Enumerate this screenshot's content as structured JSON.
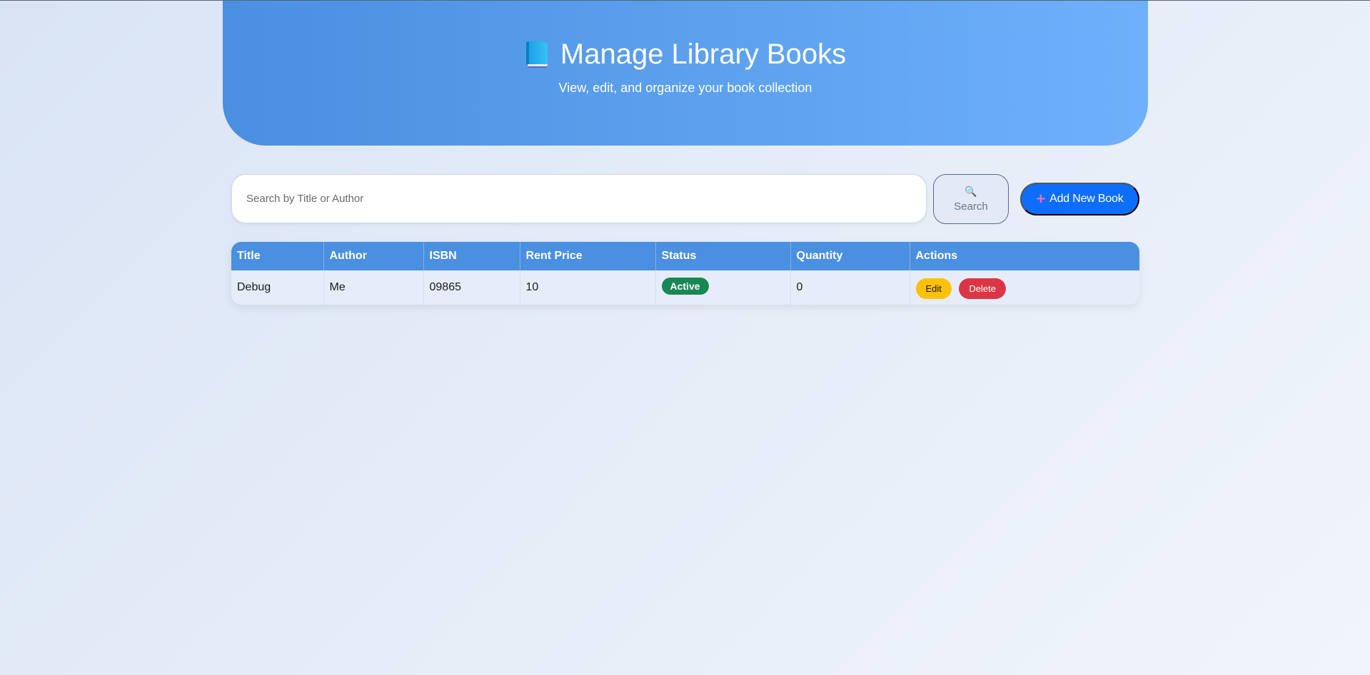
{
  "header": {
    "title": "Manage Library Books",
    "subtitle": "View, edit, and organize your book collection",
    "icon": "blue-book-icon"
  },
  "search": {
    "placeholder": "Search by Title or Author",
    "value": "",
    "button_label": "Search",
    "button_icon": "magnifier-icon"
  },
  "add_button": {
    "label": "Add New Book",
    "icon": "plus-icon"
  },
  "table": {
    "columns": [
      "Title",
      "Author",
      "ISBN",
      "Rent Price",
      "Status",
      "Quantity",
      "Actions"
    ],
    "rows": [
      {
        "title": "Debug",
        "author": "Me",
        "isbn": "09865",
        "rent_price": "10",
        "status": "Active",
        "quantity": "0",
        "edit_label": "Edit",
        "delete_label": "Delete"
      }
    ]
  },
  "colors": {
    "header_gradient_start": "#4a8fe0",
    "header_gradient_end": "#6fb0fb",
    "primary_button": "#0d6efd",
    "status_active": "#198754",
    "edit_button": "#ffc107",
    "delete_button": "#dc3545"
  }
}
